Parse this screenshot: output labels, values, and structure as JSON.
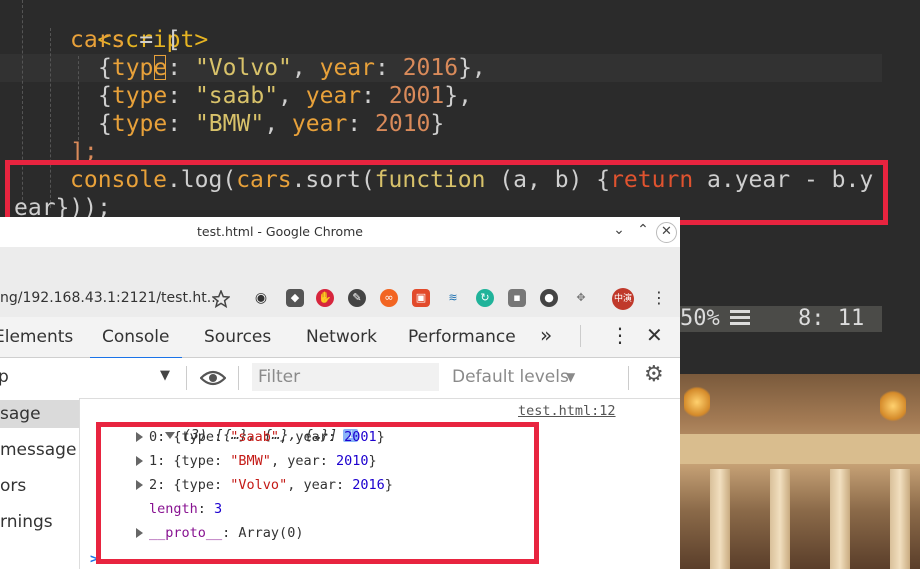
{
  "editor": {
    "tag_open": "<script>",
    "lines": {
      "l2_var": "cars",
      "l2_rest": " = [",
      "cars": [
        {
          "pre": "{",
          "k1": "type",
          "s1": ": ",
          "v1": "\"Volvo\"",
          "sep": ", ",
          "k2": "year",
          "s2": ": ",
          "v2": "2016",
          "end": "},"
        },
        {
          "pre": "{",
          "k1": "type",
          "s1": ": ",
          "v1": "\"saab\"",
          "sep": ", ",
          "k2": "year",
          "s2": ": ",
          "v2": "2001",
          "end": "},"
        },
        {
          "pre": "{",
          "k1": "type",
          "s1": ": ",
          "v1": "\"BMW\"",
          "sep": ", ",
          "k2": "year",
          "s2": ": ",
          "v2": "2010",
          "end": "}"
        }
      ],
      "close": "];",
      "log_a": "console",
      "log_b": ".log(",
      "log_c": "cars",
      "log_d": ".sort(",
      "log_e": "function",
      "log_f": " (a, b) {",
      "log_g": "return",
      "log_h": " a.year - b.y",
      "log_wrap": "ear",
      "log_end": "}));"
    },
    "status_percent": "50%",
    "status_position": "8: 11"
  },
  "chrome": {
    "window_title": "test.html - Google Chrome",
    "address": "ng/192.168.43.1:2121/test.ht...",
    "profile_badge": "中演",
    "devtools": {
      "tabs": [
        "Elements",
        "Console",
        "Sources",
        "Network",
        "Performance"
      ],
      "more_label": "»",
      "context_value": "p",
      "filter_placeholder": "Filter",
      "levels_label": "Default levels",
      "sidebar_items": [
        "sage",
        "message",
        "ors",
        "rnings"
      ],
      "console": {
        "summary": "(3) [{…}, {…}, {…}]",
        "info_badge": "i",
        "source_link": "test.html:12",
        "items": [
          {
            "index": "0",
            "type": "\"saab\"",
            "year": "2001"
          },
          {
            "index": "1",
            "type": "\"BMW\"",
            "year": "2010"
          },
          {
            "index": "2",
            "type": "\"Volvo\"",
            "year": "2016"
          }
        ],
        "length_key": "length",
        "length_val": "3",
        "proto_key": "__proto__",
        "proto_val": "Array(0)",
        "prompt": ">"
      }
    }
  }
}
